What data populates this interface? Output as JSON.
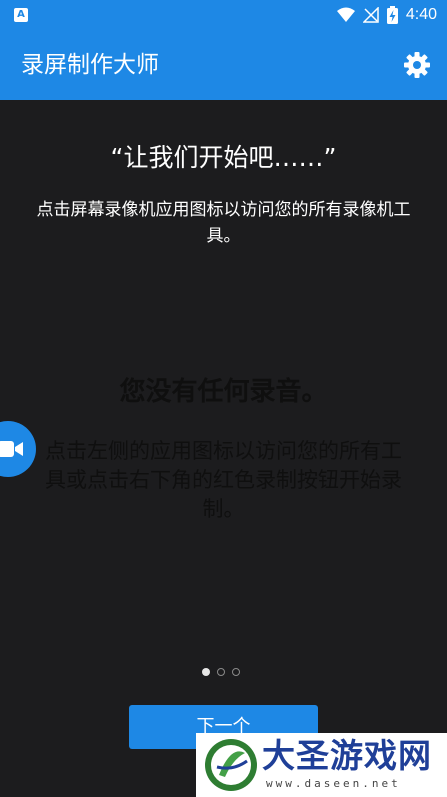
{
  "status_bar": {
    "time": "4:40",
    "app_badge": "A",
    "icons": [
      "wifi-icon",
      "no-signal-icon",
      "battery-charging-icon"
    ]
  },
  "app_bar": {
    "title": "录屏制作大师",
    "settings_icon": "gear-icon"
  },
  "onboarding": {
    "heading": "“让我们开始吧……”",
    "description": "点击屏幕录像机应用图标以访问您的所有录像机工具。",
    "page_count": 3,
    "current_page": 1,
    "next_label": "下一个"
  },
  "empty_state": {
    "title": "您没有任何录音。",
    "description": "点击左侧的应用图标以访问您的所有工具或点击右下角的红色录制按钮开始录制。"
  },
  "floating_button": {
    "icon": "video-camera-icon"
  },
  "watermark": {
    "title": "大圣游戏网",
    "url": "www.daseen.net"
  },
  "colors": {
    "accent": "#1e88e5",
    "background": "#1c1c1e",
    "watermark_blue": "#1f3f98"
  }
}
